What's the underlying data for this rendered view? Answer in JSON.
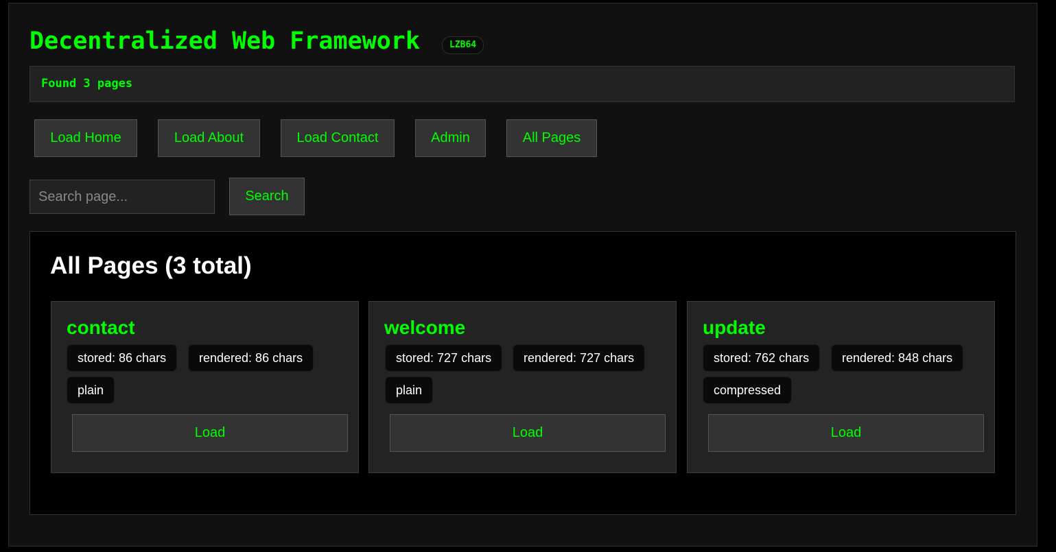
{
  "app": {
    "title": "Decentralized Web Framework",
    "badge": "LZB64",
    "status": "Found 3 pages"
  },
  "nav": {
    "buttons": [
      "Load Home",
      "Load About",
      "Load Contact",
      "Admin",
      "All Pages"
    ]
  },
  "search": {
    "placeholder": "Search page...",
    "value": "",
    "button_label": "Search"
  },
  "panel": {
    "title": "All Pages (3 total)",
    "cards": [
      {
        "name": "contact",
        "stored": "stored: 86 chars",
        "rendered": "rendered: 86 chars",
        "mode": "plain",
        "button": "Load"
      },
      {
        "name": "welcome",
        "stored": "stored: 727 chars",
        "rendered": "rendered: 727 chars",
        "mode": "plain",
        "button": "Load"
      },
      {
        "name": "update",
        "stored": "stored: 762 chars",
        "rendered": "rendered: 848 chars",
        "mode": "compressed",
        "button": "Load"
      }
    ]
  },
  "colors": {
    "accent": "#00ff00",
    "background": "#111111",
    "panel": "#000000",
    "card": "#232323",
    "button": "#333333"
  }
}
